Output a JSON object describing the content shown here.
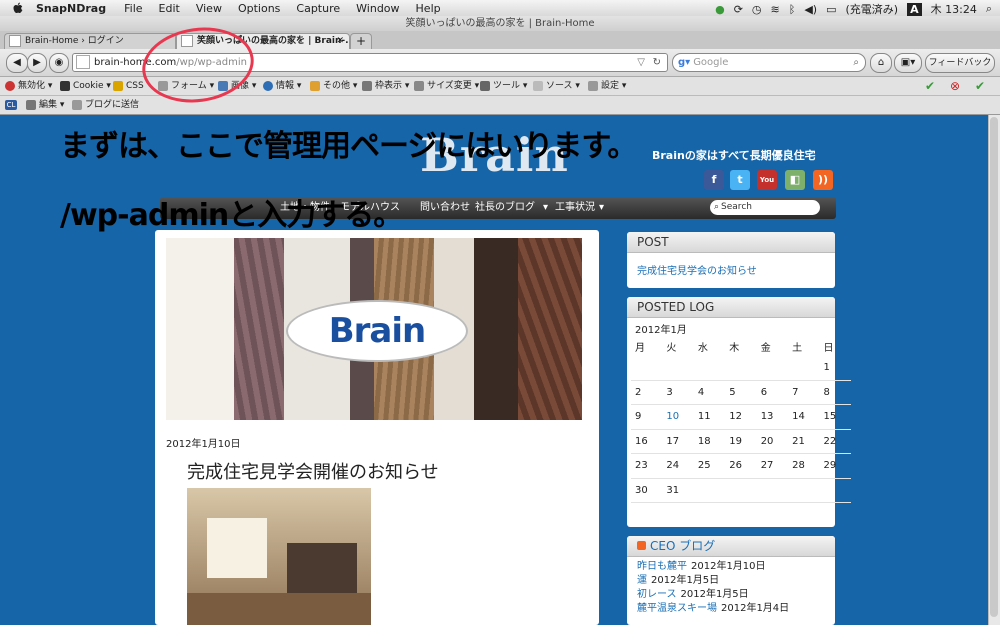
{
  "menubar": {
    "app_name": "SnapNDrag",
    "items": [
      "File",
      "Edit",
      "View",
      "Options",
      "Capture",
      "Window",
      "Help"
    ],
    "status_battery": "(充電済み)",
    "status_user": "A",
    "status_clock": "木 13:24"
  },
  "window": {
    "title": "笑顔いっぱいの最高の家を | Brain-Home"
  },
  "tabs": [
    {
      "label": "Brain-Home › ログイン"
    },
    {
      "label": "笑顔いっぱいの最高の家を | Brain-..."
    }
  ],
  "navbar": {
    "url_host": "brain-home.com",
    "url_path": "/wp/wp-admin",
    "search_placeholder": "Google",
    "feedback_label": "フィードバック"
  },
  "bookmarks_row1": [
    "無効化",
    "Cookie",
    "CSS",
    "フォーム",
    "画像",
    "情報",
    "その他",
    "枠表示",
    "サイズ変更",
    "ツール",
    "ソース",
    "設定"
  ],
  "bookmarks_row2": [
    "編集",
    "ブログに送信"
  ],
  "site": {
    "logo": "Brain",
    "tagline": "Brainの家はすべて長期優良住宅",
    "social_icons": [
      "facebook-icon",
      "twitter-icon",
      "youtube-icon",
      "feed-icon",
      "rss-icon"
    ],
    "nav": [
      "土地・物件",
      "モデルハウス",
      "問い合わせ",
      "社長のブログ",
      "工事状況"
    ],
    "search_label": "Search"
  },
  "post": {
    "date": "2012年1月10日",
    "title": "完成住宅見学会開催のお知らせ",
    "hero_logo": "Brain"
  },
  "sidebar": {
    "post_widget": {
      "title": "POST",
      "link": "完成住宅見学会のお知らせ"
    },
    "log_widget": {
      "title": "POSTED LOG",
      "month": "2012年1月",
      "weekdays": [
        "月",
        "火",
        "水",
        "木",
        "金",
        "土",
        "日"
      ],
      "weeks": [
        [
          "",
          "",
          "",
          "",
          "",
          "",
          "1"
        ],
        [
          "2",
          "3",
          "4",
          "5",
          "6",
          "7",
          "8"
        ],
        [
          "9",
          "10",
          "11",
          "12",
          "13",
          "14",
          "15"
        ],
        [
          "16",
          "17",
          "18",
          "19",
          "20",
          "21",
          "22"
        ],
        [
          "23",
          "24",
          "25",
          "26",
          "27",
          "28",
          "29"
        ],
        [
          "30",
          "31",
          "",
          "",
          "",
          "",
          ""
        ]
      ],
      "linked_day": "10"
    },
    "ceo_widget": {
      "title": "CEO ブログ",
      "entries": [
        {
          "title": "昨日も麓平",
          "date": "2012年1月10日"
        },
        {
          "title": "運",
          "date": "2012年1月5日"
        },
        {
          "title": "初レース",
          "date": "2012年1月5日"
        },
        {
          "title": "麓平温泉スキー場",
          "date": "2012年1月4日"
        }
      ]
    }
  },
  "annotation": {
    "line1": "まずは、ここで管理用ページにはいります。",
    "line2": "/wp-adminと入力する。",
    "circle_color": "#e8384f"
  }
}
